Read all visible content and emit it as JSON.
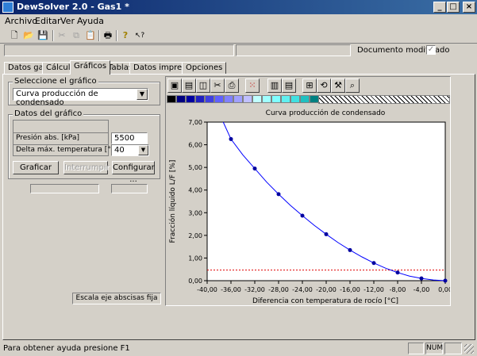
{
  "window": {
    "title": "DewSolver 2.0 - Gas1 *",
    "minimize": "_",
    "maximize": "□",
    "close": "×"
  },
  "menu": [
    "Archivo",
    "Editar",
    "Ver",
    "Ayuda"
  ],
  "toolbar": {
    "icons": [
      "new-file",
      "open-folder",
      "save-disk",
      "cut",
      "copy",
      "paste",
      "print",
      "help",
      "context-help"
    ],
    "glyphs": [
      "🗋",
      "📂",
      "💾",
      "✂",
      "⧉",
      "📋",
      "🖶",
      "?",
      "↖?"
    ]
  },
  "document_status": {
    "label": "Documento modificado",
    "checked": true
  },
  "tabs": [
    {
      "label": "Datos gas",
      "active": false
    },
    {
      "label": "Cálculo",
      "active": false
    },
    {
      "label": "Gráficos",
      "active": true
    },
    {
      "label": "Tablas",
      "active": false
    },
    {
      "label": "Datos impresión",
      "active": false
    },
    {
      "label": "Opciones",
      "active": false
    }
  ],
  "chart_select": {
    "group_label": "Seleccione el gráfico",
    "value": "Curva producción de condensado"
  },
  "chart_params": {
    "group_label": "Datos del gráfico",
    "pressure_label": "Presión abs. [kPa]",
    "pressure_value": "5500",
    "delta_label": "Delta máx. temperatura [°C]",
    "delta_value": "40"
  },
  "buttons": {
    "plot": "Graficar",
    "interrupt": "Interrumpir",
    "configure": "Configurar ..."
  },
  "fixed_axis_label": "Escala eje abscisas fija",
  "graph_palette": {
    "colors": [
      "#000000",
      "#000080",
      "#0000a0",
      "#2020c0",
      "#4040e0",
      "#6060ff",
      "#8080ff",
      "#a0a0ff",
      "#c0c0ff",
      "#c0ffff",
      "#a0ffff",
      "#80ffff",
      "#60f0f0",
      "#40e0e0",
      "#20c0c0",
      "#008080"
    ]
  },
  "chart_data": {
    "type": "scatter",
    "title": "Curva producción de condensado",
    "xlabel": "Diferencia con temperatura de rocío [°C]",
    "ylabel": "Fracción líquido L/F [%]",
    "xlim": [
      -40,
      0
    ],
    "ylim": [
      0,
      7
    ],
    "xticks": [
      "-40,00",
      "-36,00",
      "-32,00",
      "-28,00",
      "-24,00",
      "-20,00",
      "-16,00",
      "-12,00",
      "-8,00",
      "-4,00",
      "0,00"
    ],
    "yticks": [
      "0,00",
      "1,00",
      "2,00",
      "3,00",
      "4,00",
      "5,00",
      "6,00",
      "7,00"
    ],
    "x": [
      -36,
      -32,
      -28,
      -24,
      -20,
      -16,
      -12,
      -8,
      -4,
      0
    ],
    "y": [
      6.25,
      4.95,
      3.82,
      2.87,
      2.05,
      1.35,
      0.78,
      0.36,
      0.1,
      0.0
    ],
    "curve_x": [
      -37.3,
      -36,
      -34,
      -32,
      -30,
      -28,
      -26,
      -24,
      -22,
      -20,
      -18,
      -16,
      -14,
      -12,
      -10,
      -8,
      -6,
      -4,
      -2,
      0
    ],
    "curve_y": [
      7.0,
      6.25,
      5.55,
      4.95,
      4.35,
      3.82,
      3.32,
      2.87,
      2.44,
      2.05,
      1.68,
      1.35,
      1.05,
      0.78,
      0.55,
      0.36,
      0.2,
      0.1,
      0.03,
      0.0
    ],
    "reference_line_y": 0.47,
    "grid": false,
    "point_color": "#0000a0",
    "line_color": "#0000ff",
    "reference_color": "#e00000"
  },
  "status": {
    "help_text": "Para obtener ayuda presione F1",
    "num": "NUM"
  }
}
